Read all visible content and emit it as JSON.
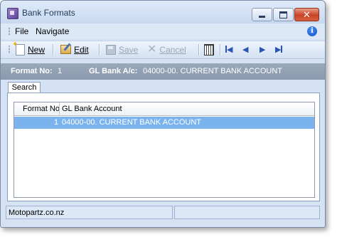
{
  "window": {
    "title": "Bank Formats",
    "close_glyph": "✕"
  },
  "menu": {
    "file": "File",
    "navigate": "Navigate",
    "info_glyph": "i"
  },
  "toolbar": {
    "new_label": "New",
    "edit_label": "Edit",
    "save_label": "Save",
    "cancel_label": "Cancel",
    "cancel_glyph": "✕"
  },
  "header": {
    "format_no_label": "Format No:",
    "format_no_value": "1",
    "gl_bank_label": "GL Bank A/c:",
    "gl_bank_value": "04000-00. CURRENT BANK ACCOUNT"
  },
  "tabs": [
    {
      "label": "Search"
    }
  ],
  "grid": {
    "columns": [
      "Format No",
      "GL Bank Account"
    ],
    "rows": [
      {
        "format_no": "1",
        "gl_bank_account": "04000-00. CURRENT BANK ACCOUNT"
      }
    ]
  },
  "status": {
    "company": "Motopartz.co.nz"
  },
  "colors": {
    "selection": "#7bb3ee",
    "header_bar": "#8a99ad",
    "window_bg": "#d4e2f4"
  }
}
